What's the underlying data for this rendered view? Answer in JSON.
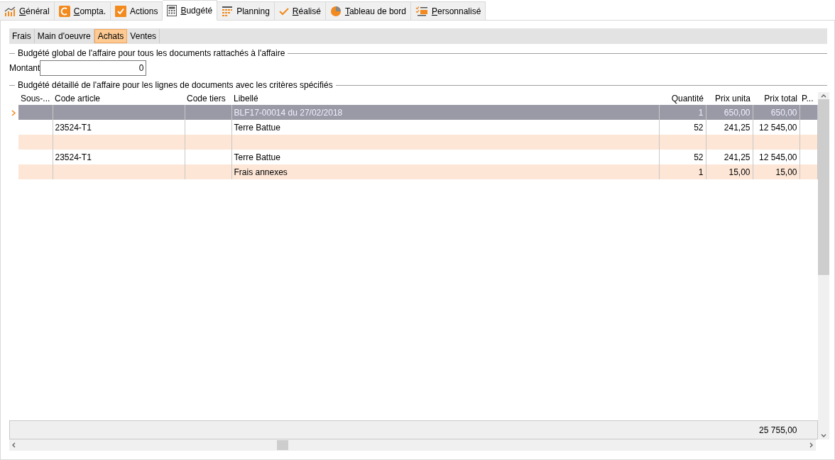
{
  "tabs": [
    {
      "label": "Général",
      "mnemonic": true,
      "selected": false
    },
    {
      "label": "Compta.",
      "mnemonic": true,
      "selected": false
    },
    {
      "label": "Actions",
      "mnemonic": false,
      "selected": false
    },
    {
      "label": "Budgété",
      "mnemonic": true,
      "selected": true
    },
    {
      "label": "Planning",
      "mnemonic": false,
      "selected": false
    },
    {
      "label": "Réalisé",
      "mnemonic": true,
      "selected": false
    },
    {
      "label": "Tableau de bord",
      "mnemonic": true,
      "selected": false
    },
    {
      "label": "Personnalisé",
      "mnemonic": true,
      "selected": false
    }
  ],
  "subtabs": [
    {
      "label": "Frais",
      "selected": false
    },
    {
      "label": "Main d'oeuvre",
      "selected": false
    },
    {
      "label": "Achats",
      "selected": true
    },
    {
      "label": "Ventes",
      "selected": false
    }
  ],
  "global_group": {
    "title": "Budgété global de l'affaire pour tous les documents rattachés à l'affaire",
    "label": "Montant",
    "value": "0"
  },
  "detail_group": {
    "title": "Budgété détaillé de l'affaire pour les lignes de documents avec les critères spécifiés",
    "columns": [
      {
        "label": "Sous-...",
        "kind": "text"
      },
      {
        "label": "Code article",
        "kind": "text"
      },
      {
        "label": "Code tiers",
        "kind": "text"
      },
      {
        "label": "Libellé",
        "kind": "text"
      },
      {
        "label": "Quantité",
        "kind": "number"
      },
      {
        "label": "Prix unita",
        "kind": "number"
      },
      {
        "label": "Prix total",
        "kind": "number"
      },
      {
        "label": "P...",
        "kind": "text"
      }
    ],
    "rows": [
      {
        "selected": true,
        "cells": [
          "",
          "",
          "",
          "BLF17-00014 du 27/02/2018",
          "1",
          "650,00",
          "650,00",
          ""
        ]
      },
      {
        "selected": false,
        "cells": [
          "",
          "23524-T1",
          "",
          "Terre Battue",
          "52",
          "241,25",
          "12 545,00",
          ""
        ]
      },
      {
        "selected": false,
        "cells": [
          "",
          "",
          "",
          "",
          "",
          "",
          "",
          ""
        ]
      },
      {
        "selected": false,
        "cells": [
          "",
          "23524-T1",
          "",
          "Terre Battue",
          "52",
          "241,25",
          "12 545,00",
          ""
        ]
      },
      {
        "selected": false,
        "cells": [
          "",
          "",
          "",
          "Frais annexes",
          "1",
          "15,00",
          "15,00",
          ""
        ]
      }
    ],
    "footer_total": "25 755,00"
  }
}
